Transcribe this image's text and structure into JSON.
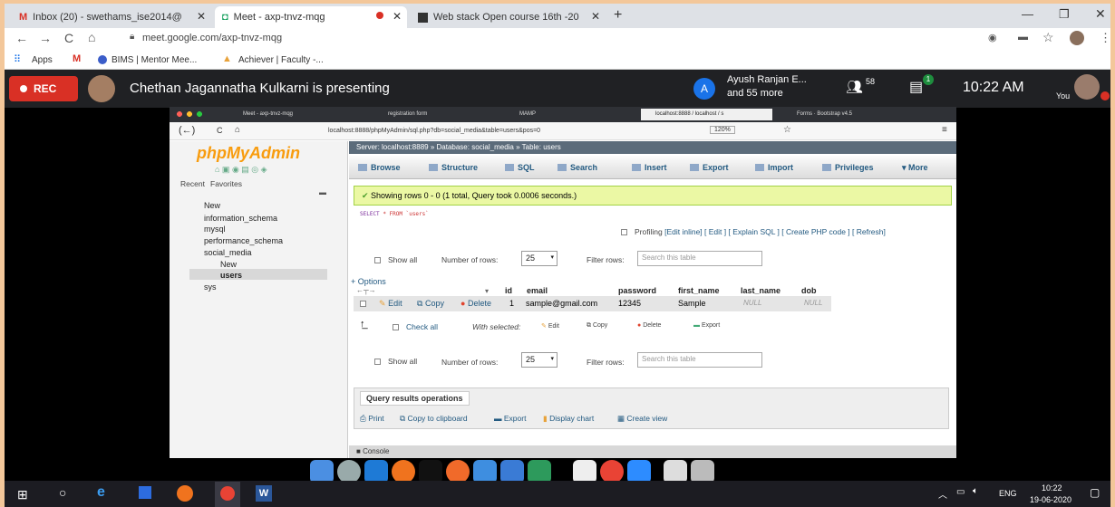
{
  "outer_browser": {
    "tabs": [
      {
        "label": "Inbox (20) - swethams_ise2014@",
        "icon": "gmail-icon"
      },
      {
        "label": "Meet - axp-tnvz-mqg",
        "icon": "meet-icon"
      },
      {
        "label": "Web stack Open course 16th -20",
        "icon": "docs-icon"
      }
    ],
    "url": "meet.google.com/axp-tnvz-mqg",
    "bookmarks": [
      "Apps",
      "BIMS | Mentor Mee...",
      "Achiever | Faculty -..."
    ]
  },
  "meet": {
    "rec_label": "REC",
    "presenter_text": "Chethan Jagannatha Kulkarni is presenting",
    "participants_avatar": "A",
    "participants_line1": "Ayush Ranjan E...",
    "participants_line2": "and 55 more",
    "people_count": "58",
    "chat_badge": "1",
    "time": "10:22 AM",
    "you_label": "You"
  },
  "inner_browser": {
    "tabs": [
      "Meet - axp-tnvz-mqg",
      "registration form",
      "MAMP",
      "localhost:8888 / localhost / s",
      "Forms · Bootstrap v4.5"
    ],
    "url": "localhost:8888/phpMyAdmin/sql.php?db=social_media&table=users&pos=0",
    "zoom": "120%"
  },
  "pma": {
    "logo": "phpMyAdmin",
    "recent": "Recent",
    "favorites": "Favorites",
    "tree": [
      "New",
      "information_schema",
      "mysql",
      "performance_schema",
      "social_media",
      "New",
      "users",
      "sys"
    ],
    "breadcrumb": "Server: localhost:8889 » Database: social_media » Table: users",
    "menu": [
      "Browse",
      "Structure",
      "SQL",
      "Search",
      "Insert",
      "Export",
      "Import",
      "Privileges",
      "More"
    ],
    "success": "Showing rows 0 - 0 (1 total, Query took 0.0006 seconds.)",
    "query_kw1": "SELECT",
    "query_rest": "* FROM `users`",
    "profiling": "Profiling",
    "profiling_links": "[Edit inline] [ Edit ] [ Explain SQL ] [ Create PHP code ] [ Refresh]",
    "show_all": "Show all",
    "num_rows_label": "Number of rows:",
    "num_rows": "25",
    "filter_label": "Filter rows:",
    "filter_placeholder": "Search this table",
    "options": "+ Options",
    "columns": [
      "id",
      "email",
      "password",
      "first_name",
      "last_name",
      "dob"
    ],
    "row": {
      "edit": "Edit",
      "copy": "Copy",
      "delete": "Delete",
      "id": "1",
      "email": "sample@gmail.com",
      "password": "12345",
      "first_name": "Sample",
      "last_name": "NULL",
      "dob": "NULL"
    },
    "check_all": "Check all",
    "with_selected": "With selected:",
    "bulk": [
      "Edit",
      "Copy",
      "Delete",
      "Export"
    ],
    "qro_title": "Query results operations",
    "qro_links": [
      "Print",
      "Copy to clipboard",
      "Export",
      "Display chart",
      "Create view"
    ],
    "console": "Console"
  },
  "taskbar": {
    "lang": "ENG",
    "time": "10:22",
    "date": "19-06-2020"
  }
}
